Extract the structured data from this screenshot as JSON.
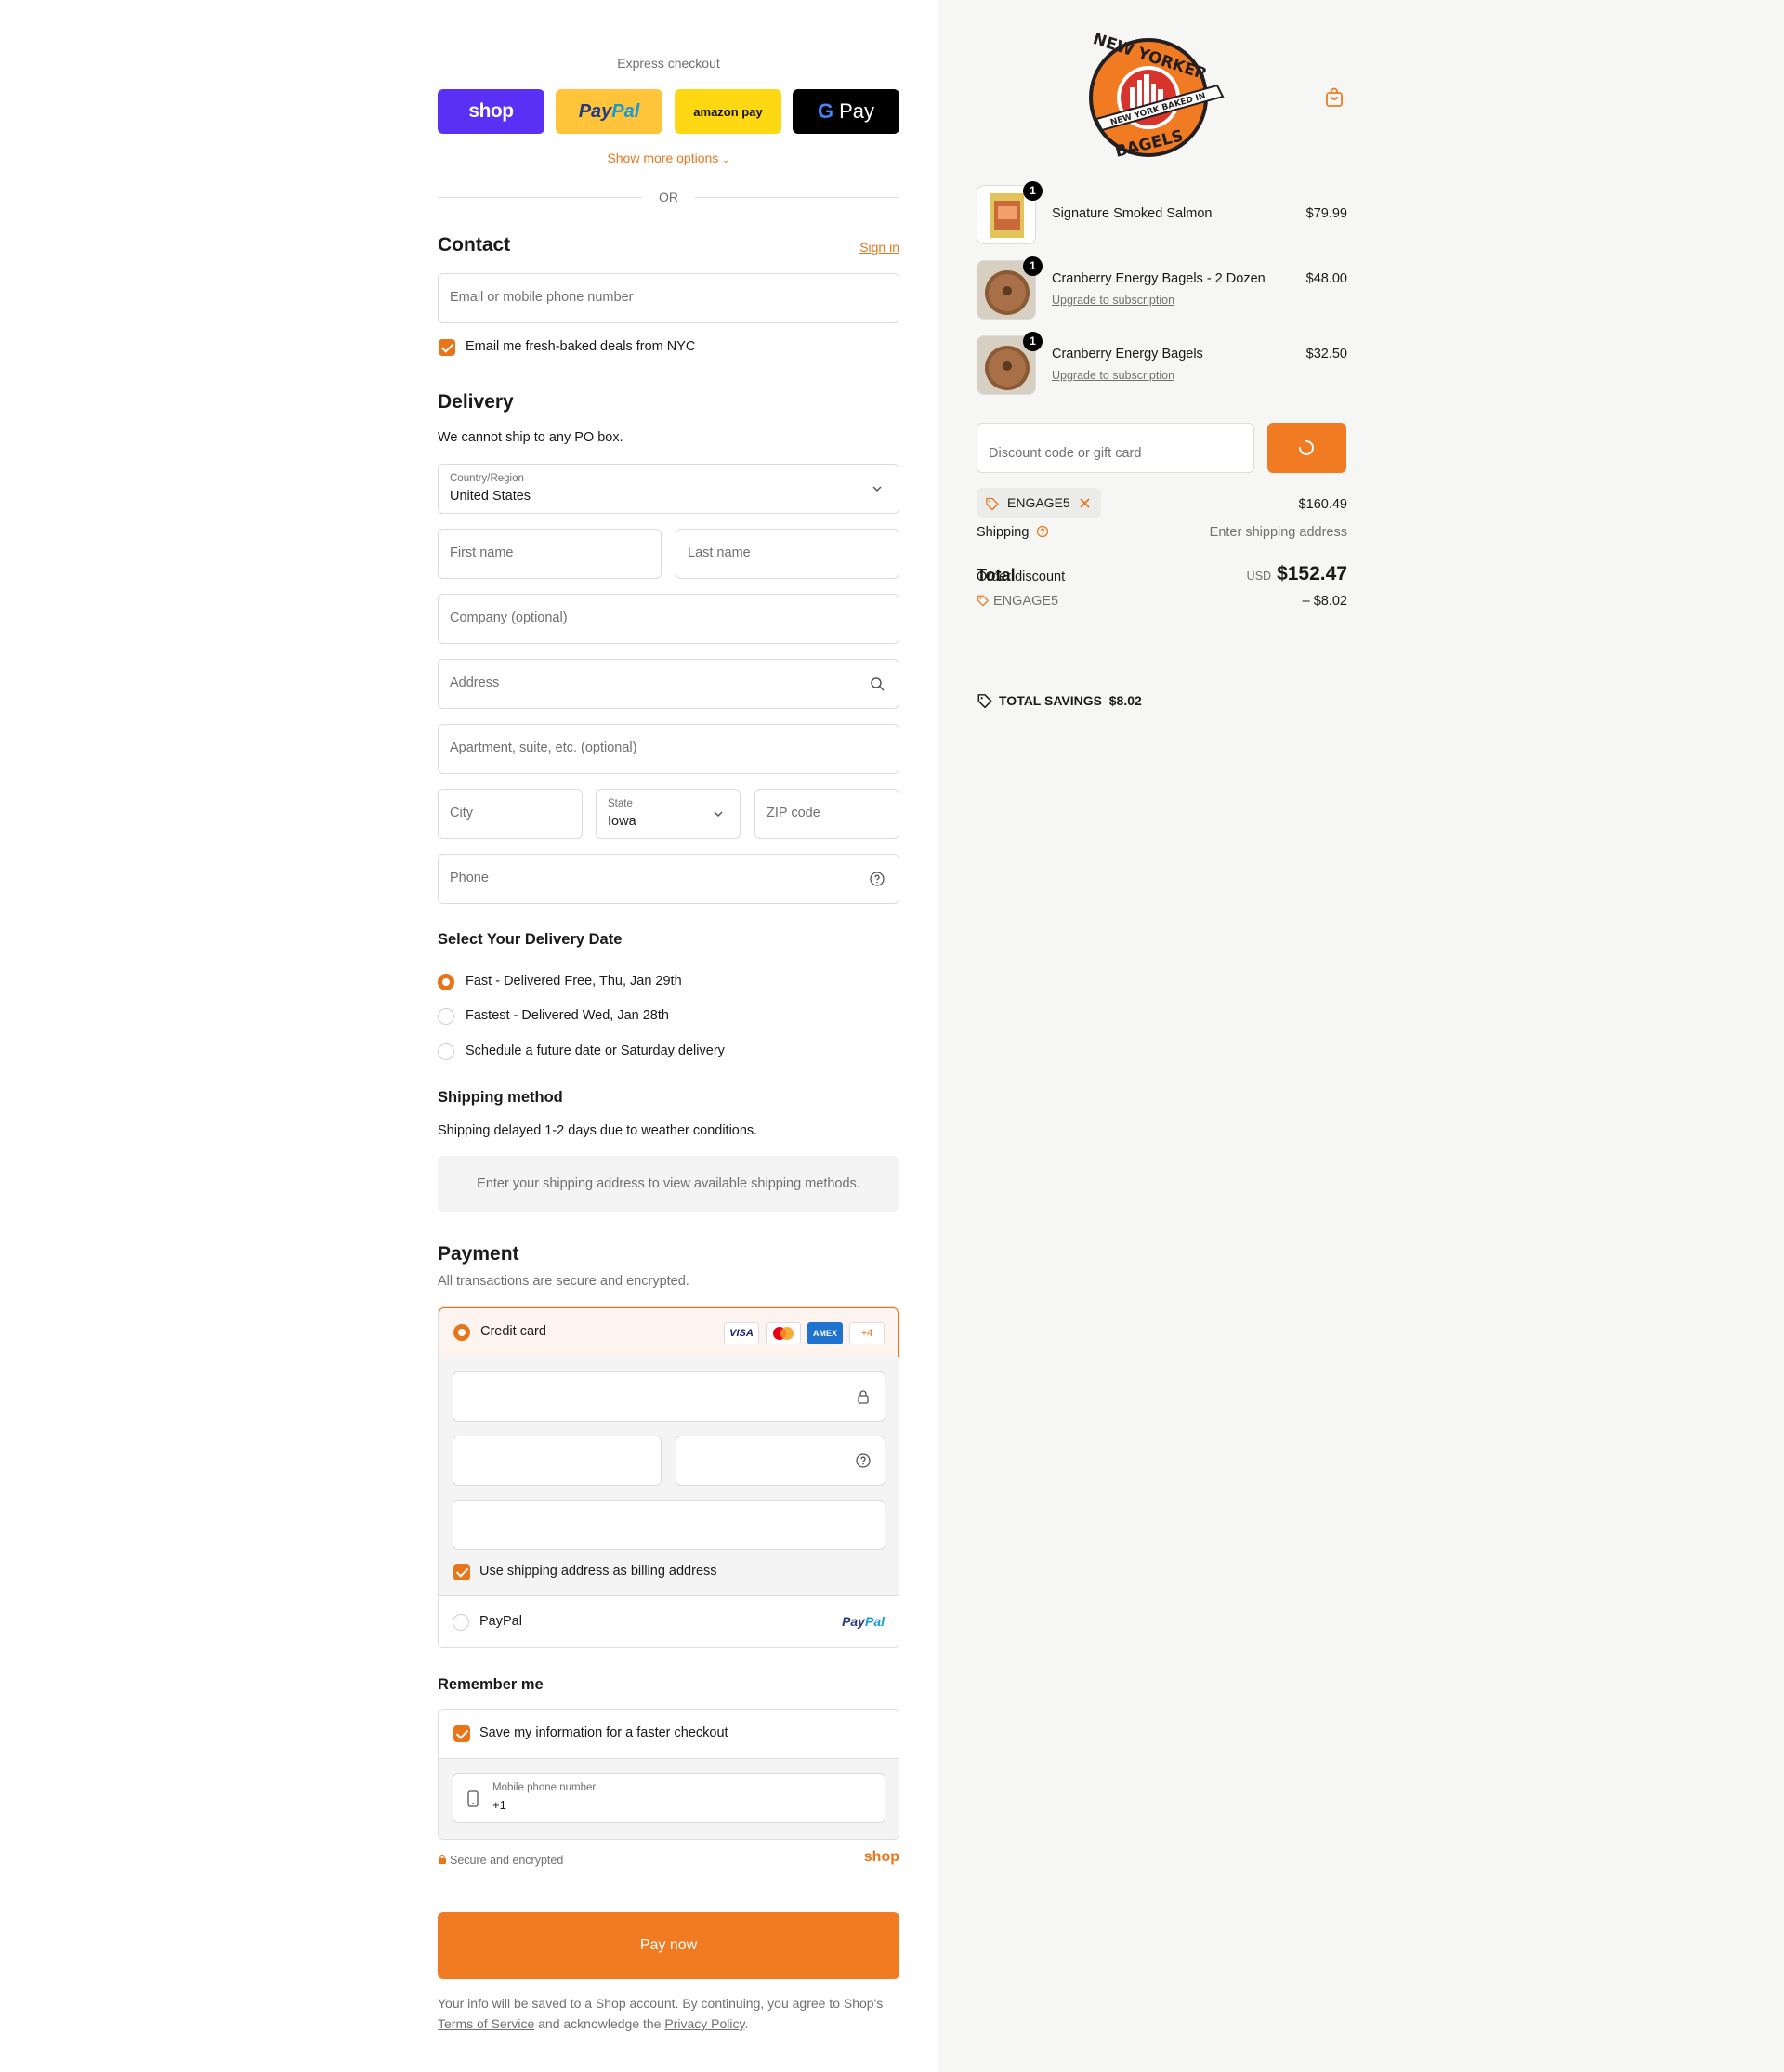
{
  "express": {
    "title": "Express checkout",
    "shop_label": "shop",
    "paypal_pay": "Pay",
    "paypal_pal": "Pal",
    "amazon_label": "amazon pay",
    "gpay_g": "G",
    "gpay_label": "Pay",
    "show_more": "Show more options",
    "or": "OR"
  },
  "contact": {
    "heading": "Contact",
    "sign_in": "Sign in",
    "email_placeholder": "Email or mobile phone number",
    "newsletter_label": "Email me fresh-baked deals from NYC"
  },
  "delivery": {
    "heading": "Delivery",
    "po_note": "We cannot ship to any PO box.",
    "country_label": "Country/Region",
    "country_value": "United States",
    "first_name": "First name",
    "last_name": "Last name",
    "company": "Company (optional)",
    "address": "Address",
    "apartment": "Apartment, suite, etc. (optional)",
    "city": "City",
    "state_label": "State",
    "state_value": "Iowa",
    "zip": "ZIP code",
    "phone": "Phone"
  },
  "delivery_date": {
    "heading": "Select Your Delivery Date",
    "options": [
      "Fast - Delivered Free, Thu, Jan 29th",
      "Fastest - Delivered Wed, Jan 28th",
      "Schedule a future date or Saturday delivery"
    ],
    "selected_index": 0
  },
  "shipping_method": {
    "heading": "Shipping method",
    "note": "Shipping delayed 1-2 days due to weather conditions.",
    "placeholder": "Enter your shipping address to view available shipping methods."
  },
  "payment": {
    "heading": "Payment",
    "subtitle": "All transactions are secure and encrypted.",
    "credit_card_label": "Credit card",
    "card_brands": [
      "VISA",
      "Mastercard",
      "AMEX",
      "+4"
    ],
    "billing_label": "Use shipping address as billing address",
    "paypal_label": "PayPal",
    "paypal_logo_pay": "Pay",
    "paypal_logo_pal": "Pal"
  },
  "remember": {
    "heading": "Remember me",
    "save_label": "Save my information for a faster checkout",
    "mobile_label": "Mobile phone number",
    "mobile_value": "+1",
    "secure_label": "Secure and encrypted",
    "shop_logo": "shop"
  },
  "pay_now": "Pay now",
  "legal": {
    "text1": "Your info will be saved to a Shop account. By continuing, you agree to Shop's",
    "terms": "Terms of Service",
    "text2": "and acknowledge the",
    "privacy": "Privacy Policy",
    "end": "."
  },
  "brand": {
    "logo_top": "NEW YORKER",
    "logo_ribbon": "NEW YORK BAKED IN",
    "logo_bottom": "BAGELS",
    "accent": "#f07b22"
  },
  "cart": {
    "items": [
      {
        "qty": "1",
        "name": "Signature Smoked Salmon",
        "price": "$79.99",
        "sub": ""
      },
      {
        "qty": "1",
        "name": "Cranberry Energy Bagels - 2 Dozen",
        "price": "$48.00",
        "sub": "Upgrade to subscription"
      },
      {
        "qty": "1",
        "name": "Cranberry Energy Bagels",
        "price": "$32.50",
        "sub": "Upgrade to subscription"
      }
    ],
    "discount_placeholder": "Discount code or gift card",
    "discount_code": "ENGAGE5",
    "subtotal_value": "$160.49",
    "shipping_label": "Shipping",
    "shipping_value": "Enter shipping address",
    "total_label": "Total",
    "order_discount_label": "Order discount",
    "currency": "USD",
    "total_value": "$152.47",
    "discount_code_line": "ENGAGE5",
    "discount_value": "– $8.02",
    "savings_label": "TOTAL SAVINGS",
    "savings_value": "$8.02"
  }
}
